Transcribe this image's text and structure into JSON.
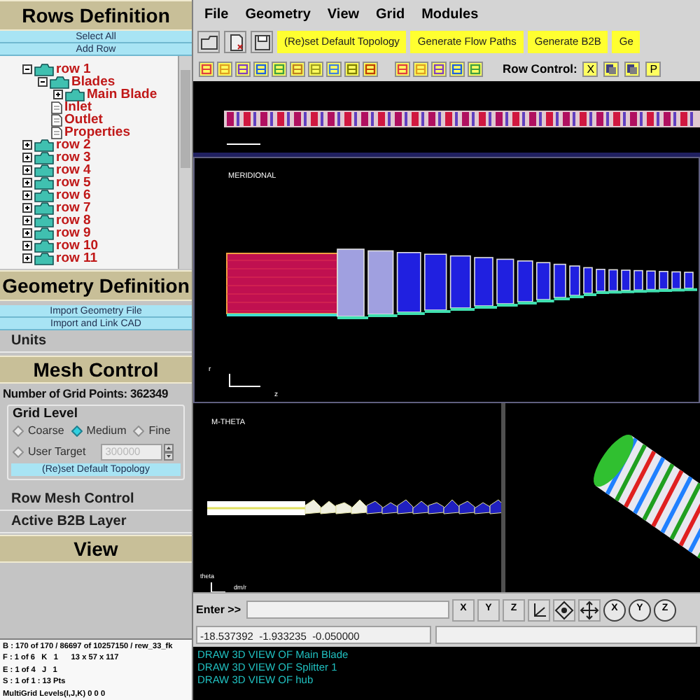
{
  "left_panel": {
    "rows_definition": {
      "title": "Rows Definition",
      "buttons": [
        "Select All",
        "Add Row"
      ],
      "tree": [
        {
          "label": "row 1",
          "kind": "folder",
          "expanded": true,
          "children": [
            {
              "label": "Blades",
              "kind": "folder",
              "expanded": true,
              "children": [
                {
                  "label": "Main Blade",
                  "kind": "folder",
                  "expanded": false
                }
              ]
            },
            {
              "label": "Inlet",
              "kind": "file"
            },
            {
              "label": "Outlet",
              "kind": "file"
            },
            {
              "label": "Properties",
              "kind": "file"
            }
          ]
        },
        {
          "label": "row 2",
          "kind": "folder",
          "expanded": false
        },
        {
          "label": "row 3",
          "kind": "folder",
          "expanded": false
        },
        {
          "label": "row 4",
          "kind": "folder",
          "expanded": false
        },
        {
          "label": "row 5",
          "kind": "folder",
          "expanded": false
        },
        {
          "label": "row 6",
          "kind": "folder",
          "expanded": false
        },
        {
          "label": "row 7",
          "kind": "folder",
          "expanded": false
        },
        {
          "label": "row 8",
          "kind": "folder",
          "expanded": false
        },
        {
          "label": "row 9",
          "kind": "folder",
          "expanded": false
        },
        {
          "label": "row 10",
          "kind": "folder",
          "expanded": false
        },
        {
          "label": "row 11",
          "kind": "folder",
          "expanded": false
        }
      ]
    },
    "geometry_definition": {
      "title": "Geometry Definition",
      "buttons": [
        "Import Geometry File",
        "Import and Link CAD"
      ],
      "sections": [
        "Units"
      ]
    },
    "mesh_control": {
      "title": "Mesh Control",
      "grid_points": "Number of Grid Points: 362349",
      "grid_level": {
        "title": "Grid Level",
        "options": [
          {
            "label": "Coarse",
            "selected": false
          },
          {
            "label": "Medium",
            "selected": true
          },
          {
            "label": "Fine",
            "selected": false
          },
          {
            "label": "User Target",
            "selected": false
          }
        ],
        "user_target": {
          "value": "300000",
          "disabled": true
        },
        "button": "(Re)set Default Topology"
      },
      "sections": [
        "Row Mesh Control",
        "Active B2B Layer"
      ]
    },
    "view": {
      "title": "View"
    },
    "info": [
      "B : 170 of 170 / 86697 of 10257150 / rew_33_fk",
      "F : 1 of 6   K   1      13 x 57 x 117",
      "E : 1 of 4   J   1",
      "S : 1 of 1 : 13 Pts",
      "MultiGrid Levels(I,J,K) 0 0 0"
    ]
  },
  "menu": [
    "File",
    "Geometry",
    "View",
    "Grid",
    "Modules"
  ],
  "toolbar_buttons": [
    "(Re)set Default Topology",
    "Generate Flow Paths",
    "Generate B2B",
    "Ge"
  ],
  "row_control": {
    "label": "Row Control:",
    "buttons": [
      {
        "kind": "text",
        "label": "X"
      },
      {
        "kind": "icon"
      },
      {
        "kind": "icon"
      },
      {
        "kind": "text",
        "label": "P"
      }
    ]
  },
  "views": {
    "meridional": {
      "title": "MERIDIONAL",
      "axis_r": "r",
      "axis_z": "z"
    },
    "m_theta": {
      "title": "M-THETA",
      "axis_theta": "theta",
      "axis_m": "dm/r"
    }
  },
  "command": {
    "prompt": "Enter >>",
    "axis_buttons": [
      "X",
      "Y",
      "Z"
    ],
    "rotate_buttons": [
      "X",
      "Y",
      "Z"
    ],
    "coordinates": "-18.537392  -1.933235  -0.050000"
  },
  "console": [
    "DRAW 3D VIEW OF Main Blade",
    "DRAW 3D VIEW OF Splitter 1",
    "DRAW 3D VIEW OF hub"
  ]
}
